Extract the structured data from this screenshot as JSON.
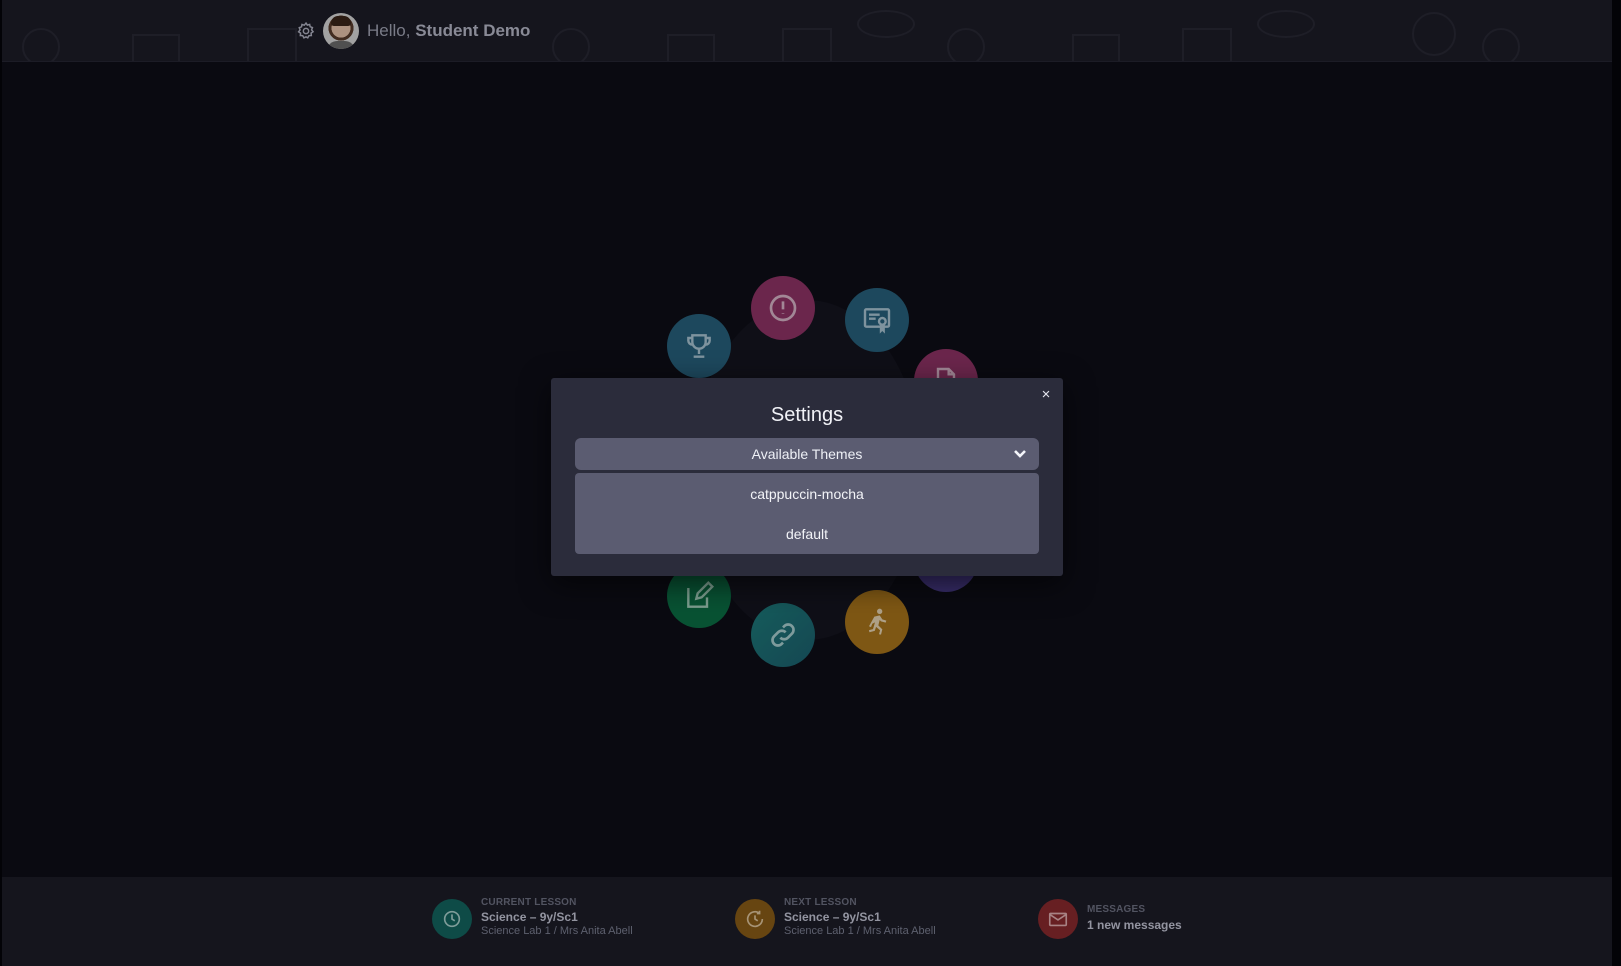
{
  "header": {
    "greeting": "Hello,",
    "user_name": "Student Demo"
  },
  "menu_icons": [
    {
      "name": "alert-icon",
      "color": "#8f3366"
    },
    {
      "name": "certificate-icon",
      "color": "#27617c"
    },
    {
      "name": "trophy-icon",
      "color": "#27617c"
    },
    {
      "name": "document-icon",
      "color": "#8f3366"
    },
    {
      "name": "edit-icon",
      "color": "#0b6e45"
    },
    {
      "name": "link-icon",
      "color": "#1b6b6e"
    },
    {
      "name": "running-icon",
      "color": "#a8741b"
    },
    {
      "name": "purple-icon",
      "color": "#4b3c8e"
    }
  ],
  "settings_modal": {
    "title": "Settings",
    "close_label": "×",
    "themes_select_label": "Available Themes",
    "theme_options": [
      "catppuccin-mocha",
      "default"
    ]
  },
  "footer": {
    "current_lesson": {
      "label": "CURRENT LESSON",
      "title": "Science – 9y/Sc1",
      "detail": "Science Lab 1 / Mrs Anita Abell",
      "color": "#13655f"
    },
    "next_lesson": {
      "label": "NEXT LESSON",
      "title": "Science – 9y/Sc1",
      "detail": "Science Lab 1 / Mrs Anita Abell",
      "color": "#8a5c17"
    },
    "messages": {
      "label": "MESSAGES",
      "title": "1 new messages",
      "color": "#8a2a2e"
    }
  }
}
